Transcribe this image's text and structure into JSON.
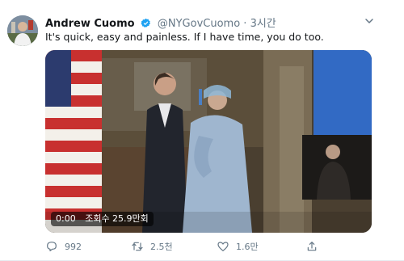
{
  "tweet": {
    "author_name": "Andrew Cuomo",
    "handle": "@NYGovCuomo",
    "separator": "·",
    "time": "3시간",
    "text": "It's quick, easy and painless. If I have time, you do too."
  },
  "media": {
    "duration": "0:00",
    "views": "조회수 25.9만회"
  },
  "actions": {
    "replies": "992",
    "retweets": "2.5천",
    "likes": "1.6만",
    "share": ""
  },
  "colors": {
    "verified": "#1da1f2",
    "text_secondary": "#657786",
    "name": "#14171a"
  },
  "icons": [
    "verified-badge-icon",
    "caret-down-icon",
    "reply-icon",
    "retweet-icon",
    "like-icon",
    "share-icon"
  ]
}
